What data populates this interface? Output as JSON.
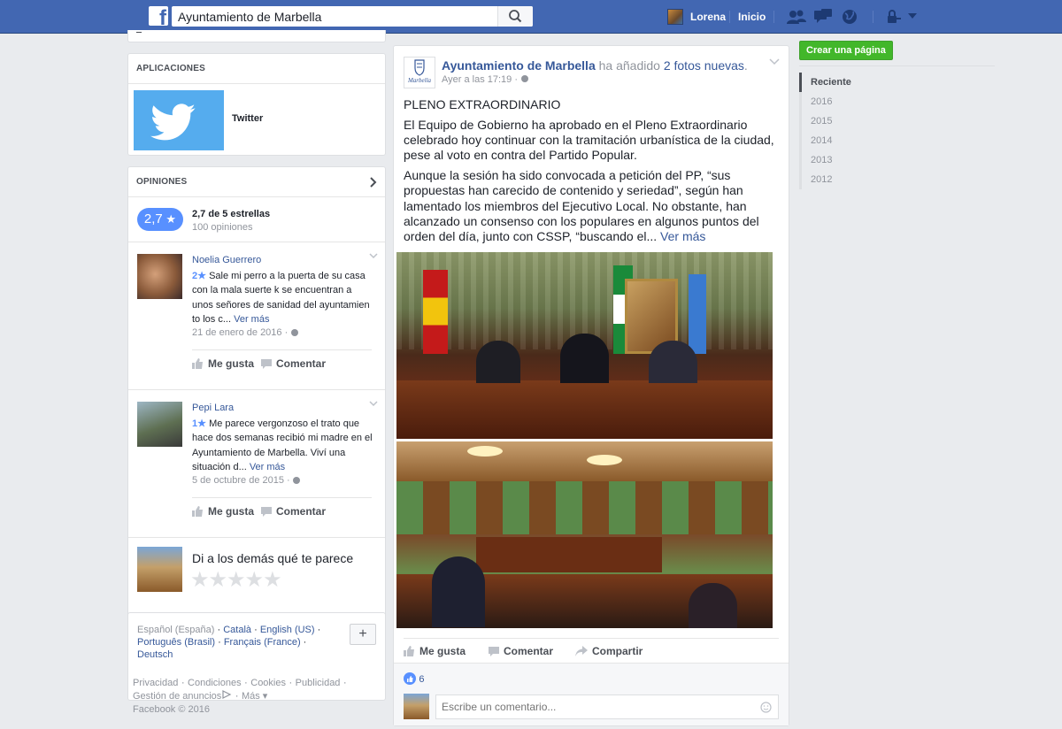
{
  "header": {
    "search_value": "Ayuntamiento de Marbella",
    "user_name": "Lorena",
    "home_label": "Inicio"
  },
  "apps": {
    "title": "APLICACIONES",
    "twitter_label": "Twitter"
  },
  "reviews": {
    "title": "OPINIONES",
    "score": "2,7",
    "summary": "2,7 de 5 estrellas",
    "count": "100 opiniones",
    "items": [
      {
        "author": "Noelia Guerrero",
        "stars": "2",
        "text": "Sale mi perro a la puerta de su casa con la mala suerte k se encuentran a unos señores de sanidad del ayuntamien to los c...",
        "see_more": "Ver más",
        "date": "21 de enero de 2016 ·",
        "like": "Me gusta",
        "comment": "Comentar"
      },
      {
        "author": "Pepi Lara",
        "stars": "1",
        "text": "Me parece vergonzoso el trato que hace dos semanas recibió mi madre en el Ayuntamiento de Marbella. Viví una situación d...",
        "see_more": "Ver más",
        "date": "5 de octubre de 2015 ·",
        "like": "Me gusta",
        "comment": "Comentar"
      }
    ],
    "prompt": "Di a los demás qué te parece"
  },
  "languages": {
    "current": "Español (España)",
    "links": [
      "Català",
      "English (US)",
      "Português (Brasil)",
      "Français (France)",
      "Deutsch"
    ]
  },
  "footer": {
    "links": [
      "Privacidad",
      "Condiciones",
      "Cookies",
      "Publicidad",
      "Gestión de anuncios",
      "Más"
    ],
    "copyright": "Facebook © 2016"
  },
  "post": {
    "page_name": "Ayuntamiento de Marbella",
    "action_text": "ha añadido",
    "photos_link": "2 fotos nuevas",
    "time": "Ayer a las 17:19 ·",
    "logo_text": "Marbella",
    "heading": "PLENO EXTRAORDINARIO",
    "paragraph1": "El Equipo de Gobierno ha aprobado en el Pleno Extraordinario celebrado hoy continuar con la tramitación urbanística de la ciudad, pese al voto en contra del Partido Popular.",
    "paragraph2": "Aunque la sesión ha sido convocada a petición del PP, “sus propuestas han carecido de contenido y seriedad”, según han lamentado los miembros del Ejecutivo Local. No obstante, han alcanzado un consenso con los populares en algunos puntos del orden del día, junto con CSSP, “buscando el...",
    "see_more": "Ver más",
    "like": "Me gusta",
    "comment": "Comentar",
    "share": "Compartir",
    "likes_count": "6",
    "comment_placeholder": "Escribe un comentario..."
  },
  "sidebar": {
    "create_page": "Crear una página",
    "years": [
      "Reciente",
      "2016",
      "2015",
      "2014",
      "2013",
      "2012"
    ]
  },
  "colors": {
    "brand": "#4267b2",
    "link": "#365899",
    "create_button": "#42b72a"
  }
}
